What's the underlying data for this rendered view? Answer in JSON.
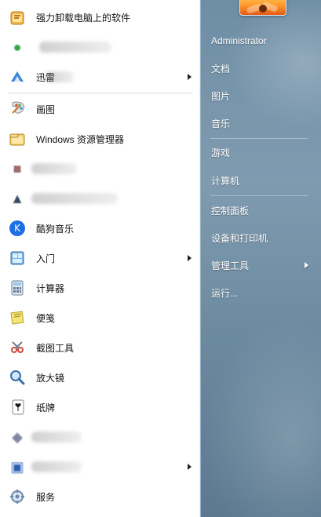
{
  "window": {
    "user_name": "Administrator"
  },
  "left_menu": {
    "items": [
      {
        "label": "强力卸载电脑上的软件",
        "icon": "uninstall-tool-icon",
        "has_arrow": false,
        "blurred": false
      },
      {
        "label": "",
        "icon": "blurred-app-icon",
        "has_arrow": false,
        "blurred": true
      },
      {
        "label": "迅雷",
        "icon": "thunder-download-icon",
        "has_arrow": true,
        "blurred": true
      },
      {
        "label": "画图",
        "icon": "paint-icon",
        "has_arrow": false,
        "blurred": false
      },
      {
        "label": "Windows 资源管理器",
        "icon": "explorer-icon",
        "has_arrow": false,
        "blurred": false
      },
      {
        "label": "",
        "icon": "blurred-app-icon",
        "has_arrow": false,
        "blurred": true
      },
      {
        "label": "",
        "icon": "blurred-app-icon",
        "has_arrow": false,
        "blurred": true
      },
      {
        "label": "酷狗音乐",
        "icon": "kugou-music-icon",
        "has_arrow": false,
        "blurred": false
      },
      {
        "label": "入门",
        "icon": "getting-started-icon",
        "has_arrow": true,
        "blurred": false
      },
      {
        "label": "计算器",
        "icon": "calculator-icon",
        "has_arrow": false,
        "blurred": false
      },
      {
        "label": "便笺",
        "icon": "sticky-notes-icon",
        "has_arrow": false,
        "blurred": false
      },
      {
        "label": "截图工具",
        "icon": "snipping-tool-icon",
        "has_arrow": false,
        "blurred": false
      },
      {
        "label": "放大镜",
        "icon": "magnifier-icon",
        "has_arrow": false,
        "blurred": false
      },
      {
        "label": "纸牌",
        "icon": "solitaire-icon",
        "has_arrow": false,
        "blurred": false
      },
      {
        "label": "",
        "icon": "blurred-app-icon",
        "has_arrow": false,
        "blurred": true
      },
      {
        "label": "",
        "icon": "blurred-app-icon",
        "has_arrow": true,
        "blurred": true
      },
      {
        "label": "服务",
        "icon": "services-icon",
        "has_arrow": false,
        "blurred": false
      }
    ]
  },
  "right_menu": {
    "items": [
      {
        "label": "Administrator",
        "has_arrow": false
      },
      {
        "label": "文档",
        "has_arrow": false
      },
      {
        "label": "图片",
        "has_arrow": false
      },
      {
        "label": "音乐",
        "has_arrow": false
      },
      {
        "label": "游戏",
        "has_arrow": false
      },
      {
        "label": "计算机",
        "has_arrow": false
      },
      {
        "label": "控制面板",
        "has_arrow": false
      },
      {
        "label": "设备和打印机",
        "has_arrow": false
      },
      {
        "label": "管理工具",
        "has_arrow": true
      },
      {
        "label": "运行...",
        "has_arrow": false
      }
    ]
  },
  "colors": {
    "left_bg": "#ffffff",
    "right_bg_top": "#6e8ea5",
    "right_bg_bottom": "#5b7990",
    "text_dark": "#111111",
    "text_light": "#ffffff"
  }
}
